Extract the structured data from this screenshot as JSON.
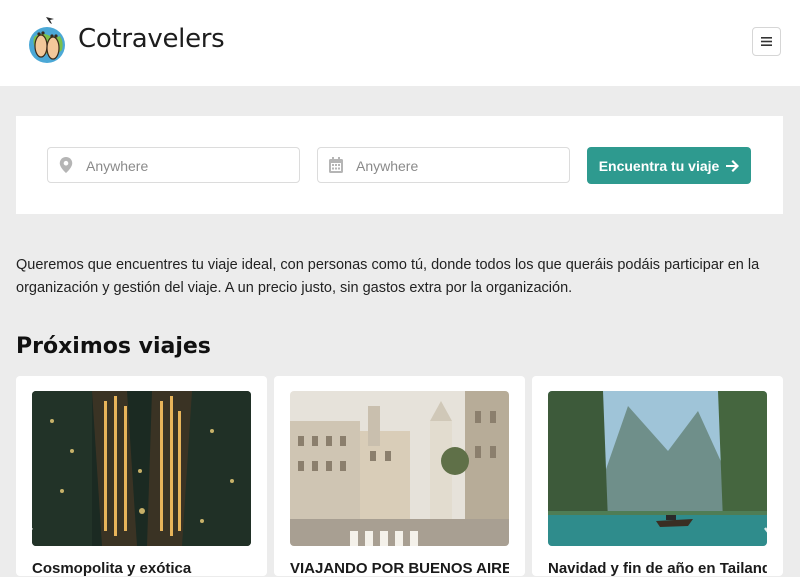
{
  "header": {
    "brand": "Cotravelers",
    "menu_icon": "hamburger-icon"
  },
  "search": {
    "location_placeholder": "Anywhere",
    "date_placeholder": "Anywhere",
    "button_label": "Encuentra tu viaje",
    "location_icon": "map-pin-icon",
    "date_icon": "calendar-icon",
    "button_icon": "arrow-right-icon"
  },
  "intro": {
    "text": "Queremos que encuentres tu viaje ideal, con personas como tú, donde todos los que queráis podáis participar en la organización y gestión del viaje. A un precio justo, sin gastos extra por la organización."
  },
  "trips": {
    "title": "Próximos viajes",
    "cards": [
      {
        "title": "Cosmopolita y exótica"
      },
      {
        "title": "VIAJANDO POR BUENOS AIRES"
      },
      {
        "title": "Navidad y fin de año en Tailandia"
      }
    ]
  },
  "colors": {
    "accent": "#2e9a8f",
    "background": "#ececec"
  }
}
